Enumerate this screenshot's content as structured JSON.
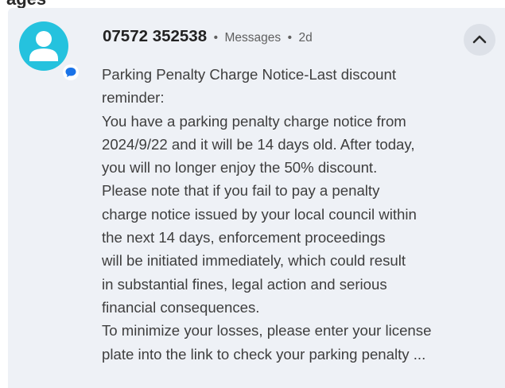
{
  "section_header": "ages",
  "notification": {
    "sender": "07572 352538",
    "separator": "•",
    "app_name": "Messages",
    "age": "2d",
    "avatar_icon": "person-icon",
    "app_badge_icon": "chat-bubble-icon",
    "collapse_icon": "chevron-up-icon",
    "accent_color": "#25c2de",
    "badge_color": "#1a73e8",
    "body_lines": [
      "Parking Penalty Charge Notice-Last discount",
      "reminder:",
      "You have a parking penalty charge notice from",
      "2024/9/22 and it will be 14 days old. After today,",
      "you will no longer enjoy the 50% discount.",
      "Please note that if you fail to pay a penalty",
      "charge notice issued by your local council within",
      "the next 14 days, enforcement proceedings",
      "will be initiated immediately, which could result",
      "in substantial fines, legal action and serious",
      "financial consequences.",
      "To minimize your losses, please enter your license",
      "plate into the link to check your parking penalty ..."
    ]
  }
}
